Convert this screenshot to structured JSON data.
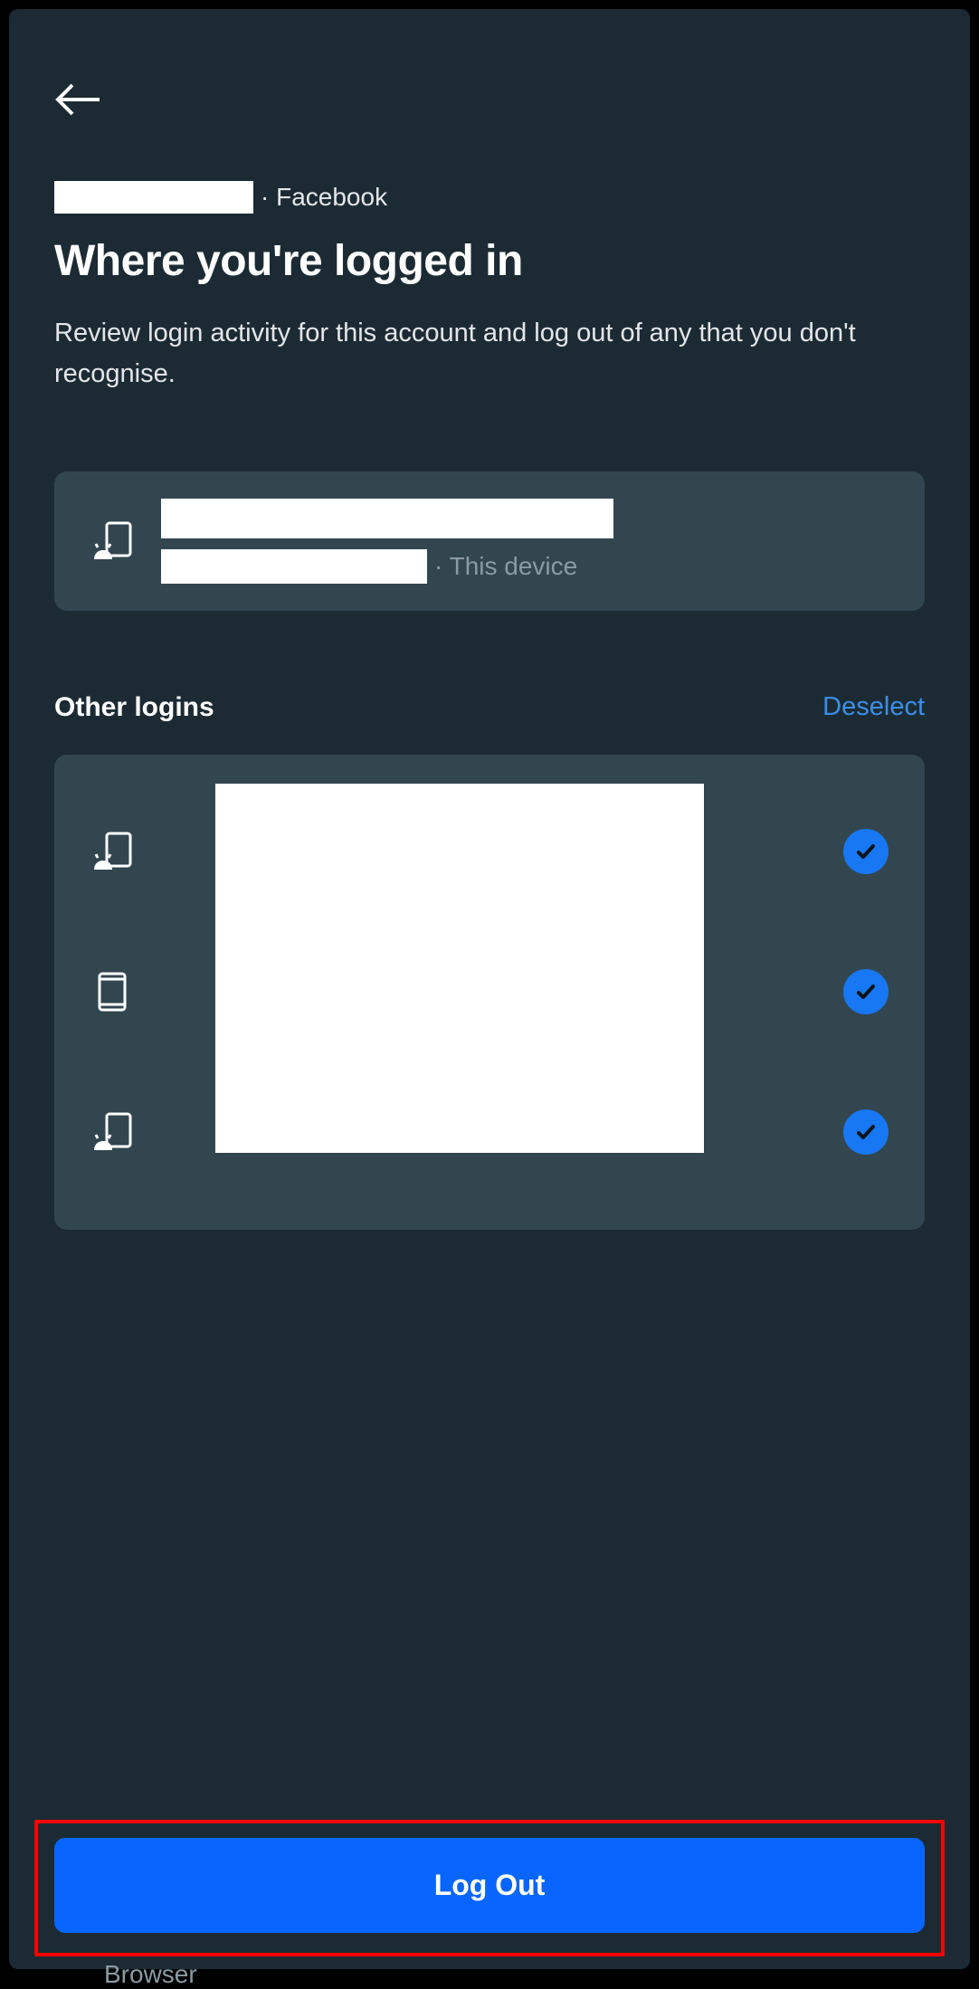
{
  "breadcrumb": {
    "suffix": "· Facebook"
  },
  "page": {
    "title": "Where you're logged in",
    "description": "Review login activity for this account and log out of any that you don't recognise."
  },
  "current_device": {
    "label": "· This device",
    "icon": "android-device-icon"
  },
  "other_logins": {
    "heading": "Other logins",
    "deselect_label": "Deselect",
    "items": [
      {
        "icon": "android-device-icon",
        "selected": true
      },
      {
        "icon": "tablet-icon",
        "selected": true
      },
      {
        "icon": "android-device-icon",
        "selected": true
      }
    ]
  },
  "footer": {
    "logout_label": "Log Out"
  },
  "peek": {
    "browser_text": "Browser"
  },
  "colors": {
    "accent": "#1877f2",
    "logout_bg": "#0866ff",
    "highlight": "#ff0000"
  }
}
